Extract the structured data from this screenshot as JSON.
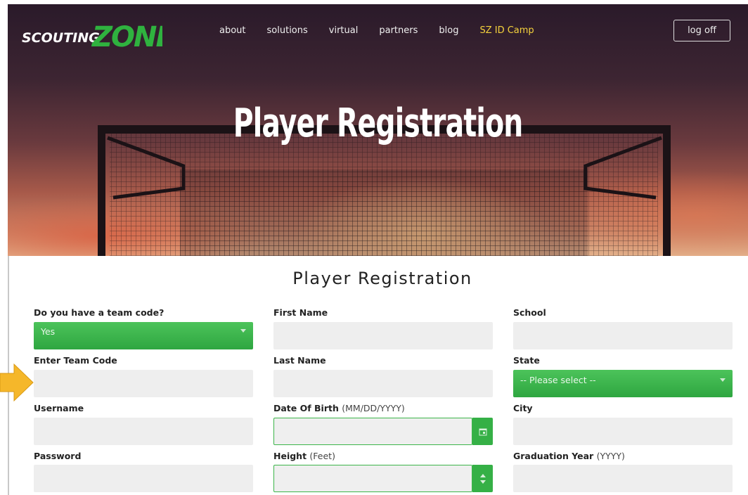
{
  "brand": {
    "logo_text_left": "SCOUTING",
    "logo_text_right": "ZONE"
  },
  "nav": {
    "links": [
      "about",
      "solutions",
      "virtual",
      "partners",
      "blog",
      "SZ ID Camp"
    ],
    "logoff_label": "log off"
  },
  "hero": {
    "title": "Player Registration"
  },
  "form": {
    "title": "Player Registration",
    "team_code_question": "Do you have a team code?",
    "team_code_value": "Yes",
    "enter_team_code": "Enter Team Code",
    "username": "Username",
    "password": "Password",
    "first_name": "First Name",
    "last_name": "Last Name",
    "dob_label": "Date Of Birth",
    "dob_hint": "(MM/DD/YYYY)",
    "height_label": "Height",
    "height_hint": "(Feet)",
    "school": "School",
    "state": "State",
    "state_value": "-- Please select --",
    "city": "City",
    "grad_label": "Graduation Year",
    "grad_hint": "(YYYY)"
  },
  "colors": {
    "accent_green": "#35b046",
    "nav_highlight": "#f5d23c",
    "arrow": "#f5b72a"
  }
}
